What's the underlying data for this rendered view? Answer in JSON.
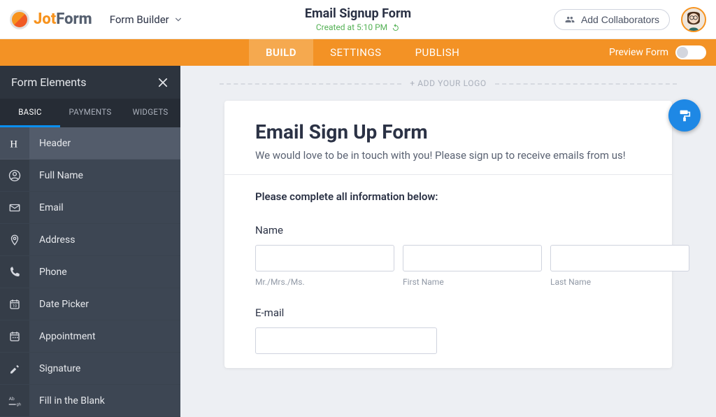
{
  "brand": {
    "name1": "Jot",
    "name2": "Form"
  },
  "formBuilder": {
    "label": "Form Builder"
  },
  "formTitle": "Email Signup Form",
  "createdAt": "Created at 5:10 PM",
  "collab": {
    "label": "Add Collaborators"
  },
  "tabs": {
    "build": "BUILD",
    "settings": "SETTINGS",
    "publish": "PUBLISH"
  },
  "preview": {
    "label": "Preview Form"
  },
  "sidebar": {
    "title": "Form Elements",
    "tabs": {
      "basic": "BASIC",
      "payments": "PAYMENTS",
      "widgets": "WIDGETS"
    },
    "items": [
      {
        "label": "Header"
      },
      {
        "label": "Full Name"
      },
      {
        "label": "Email"
      },
      {
        "label": "Address"
      },
      {
        "label": "Phone"
      },
      {
        "label": "Date Picker"
      },
      {
        "label": "Appointment"
      },
      {
        "label": "Signature"
      },
      {
        "label": "Fill in the Blank"
      }
    ]
  },
  "canvas": {
    "addLogo": "+ ADD YOUR LOGO",
    "heading": "Email Sign Up Form",
    "subheading": "We would love to be in touch with you! Please sign up to receive emails from us!",
    "instruction": "Please complete all information below:",
    "nameLabel": "Name",
    "prefixSub": "Mr./Mrs./Ms.",
    "firstSub": "First Name",
    "lastSub": "Last Name",
    "emailLabel": "E-mail"
  }
}
